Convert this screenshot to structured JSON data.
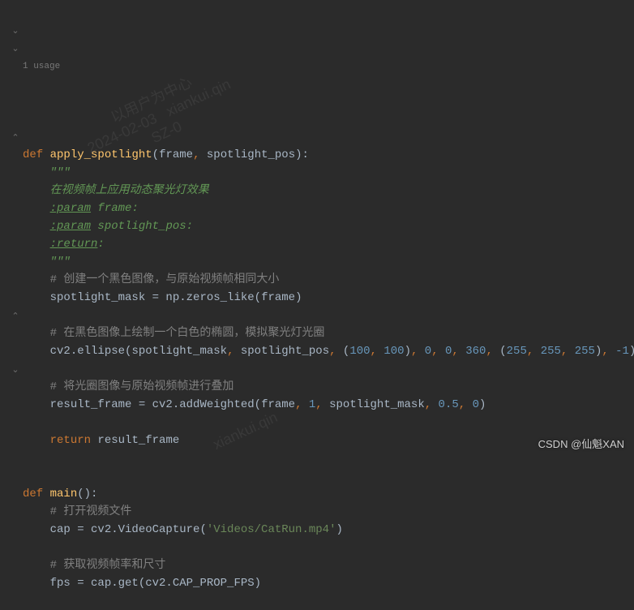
{
  "usage": "1 usage",
  "func1": {
    "def": "def",
    "name": "apply_spotlight",
    "params_open": "(",
    "p1": "frame",
    "comma": ",",
    "p2": "spotlight_pos",
    "params_close": ")",
    "colon": ":"
  },
  "doc": {
    "open": "\"\"\"",
    "line1": "在视频帧上应用动态聚光灯效果",
    "tag_param": ":param",
    "p1_name": " frame:",
    "p2_name": " spotlight_pos:",
    "tag_return": ":return",
    "ret_colon": ":",
    "close": "\"\"\""
  },
  "c1": "# 创建一个黑色图像，与原始视频帧相同大小",
  "l1": {
    "a": "spotlight_mask = np.zeros_like(",
    "b": "frame",
    "c": ")"
  },
  "c2": "# 在黑色图像上绘制一个白色的椭圆，模拟聚光灯光圈",
  "l2": {
    "a": "cv2.ellipse(",
    "b": "spotlight_mask",
    "c": "spotlight_pos",
    "n100a": "100",
    "n100b": "100",
    "n0a": "0",
    "n0b": "0",
    "n360": "360",
    "n255a": "255",
    "n255b": "255",
    "n255c": "255",
    "nm1": "-1",
    "close": ")"
  },
  "c3": "# 将光圈图像与原始视频帧进行叠加",
  "l3": {
    "a": "result_frame = cv2.addWeighted(",
    "b": "frame",
    "n1": "1",
    "c": "spotlight_mask",
    "n05": "0.5",
    "n0": "0",
    "close": ")"
  },
  "ret": {
    "kw": "return",
    "val": " result_frame"
  },
  "func2": {
    "def": "def",
    "name": "main",
    "parens": "()",
    "colon": ":"
  },
  "c4": "# 打开视频文件",
  "l4": {
    "a": "cap = cv2.VideoCapture(",
    "s": "'Videos/CatRun.mp4'",
    "close": ")"
  },
  "c5": "# 获取视频帧率和尺寸",
  "l5": {
    "a": "fps = cap.get(cv2.CAP_PROP_FPS)"
  },
  "watermark1": "以用户为中心\n2024-02-03   xiankui.qin\nSZ-0",
  "watermark2": "xiankui.qin",
  "csdn": "CSDN @仙魁XAN"
}
